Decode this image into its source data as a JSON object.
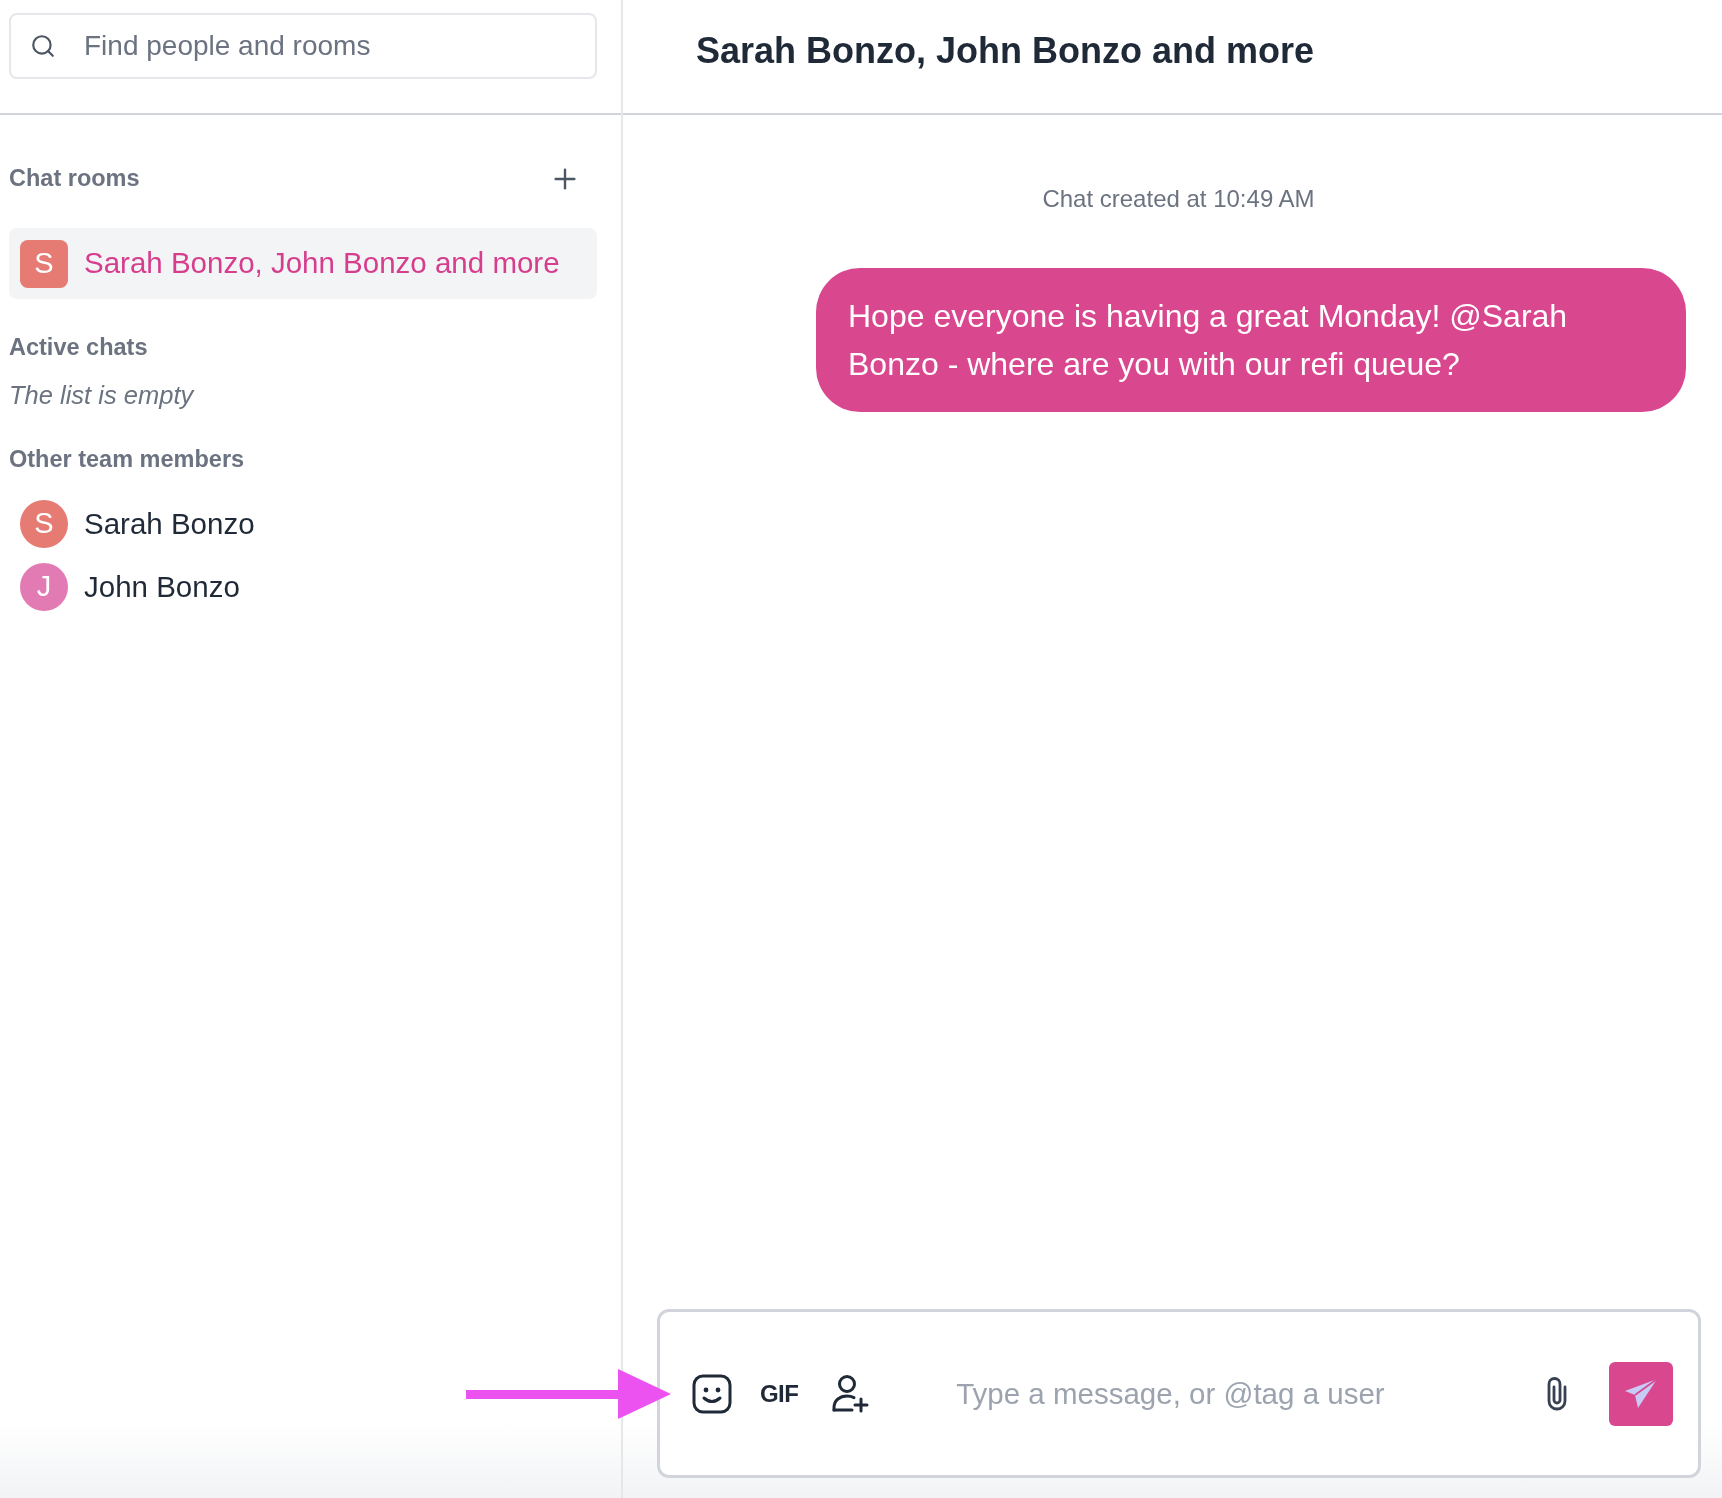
{
  "search": {
    "placeholder": "Find people and rooms"
  },
  "chat_rooms": {
    "heading": "Chat rooms",
    "items": [
      {
        "initial": "S",
        "name": "Sarah Bonzo, John Bonzo and more",
        "color": "#e57b72",
        "selected": true
      }
    ]
  },
  "active_chats": {
    "heading": "Active chats",
    "empty_text": "The list is empty"
  },
  "team_members": {
    "heading": "Other team members",
    "items": [
      {
        "initial": "S",
        "name": "Sarah Bonzo",
        "color": "#e57b72"
      },
      {
        "initial": "J",
        "name": "John Bonzo",
        "color": "#e27ab4"
      }
    ]
  },
  "conversation": {
    "title": "Sarah Bonzo, John Bonzo and more",
    "messages": [
      {
        "kind": "system",
        "text": "Chat created at 10:49 AM"
      },
      {
        "kind": "outgoing",
        "text": "Hope everyone is having a great Monday! @Sarah Bonzo - where are you with our refi queue?"
      }
    ]
  },
  "composer": {
    "gif_label": "GIF",
    "placeholder": "Type a message, or @tag a user"
  }
}
